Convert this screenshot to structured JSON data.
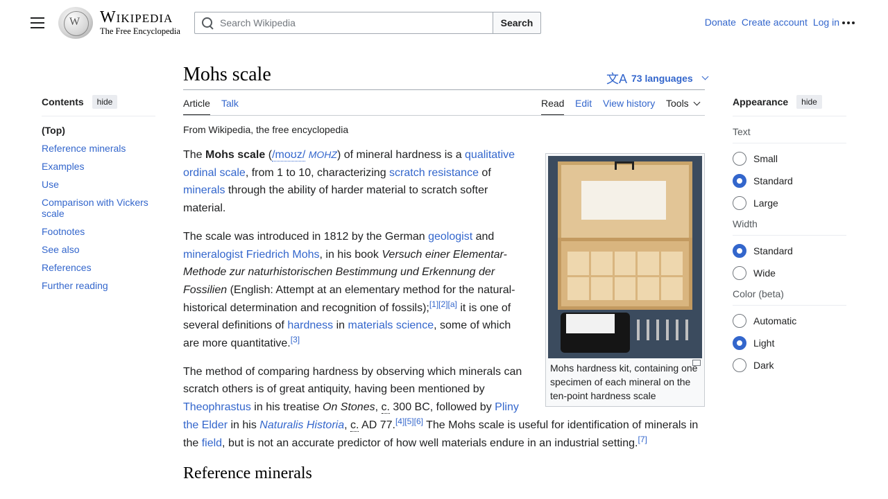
{
  "header": {
    "logo_title": "Wikipedia",
    "logo_tagline": "The Free Encyclopedia",
    "search_placeholder": "Search Wikipedia",
    "search_button": "Search",
    "user_links": [
      "Donate",
      "Create account",
      "Log in"
    ]
  },
  "article": {
    "title": "Mohs scale",
    "languages": "73 languages",
    "tabs_left": [
      "Article",
      "Talk"
    ],
    "tabs_right": [
      "Read",
      "Edit",
      "View history",
      "Tools"
    ],
    "from": "From Wikipedia, the free encyclopedia",
    "caption": "Mohs hardness kit, containing one specimen of each mineral on the ten-point hardness scale",
    "next_heading": "Reference minerals"
  },
  "toc": {
    "title": "Contents",
    "hide": "hide",
    "items": [
      "(Top)",
      "Reference minerals",
      "Examples",
      "Use",
      "Comparison with Vickers scale",
      "Footnotes",
      "See also",
      "References",
      "Further reading"
    ]
  },
  "appearance": {
    "title": "Appearance",
    "hide": "hide",
    "text_label": "Text",
    "text_options": [
      "Small",
      "Standard",
      "Large"
    ],
    "text_selected": "Standard",
    "width_label": "Width",
    "width_options": [
      "Standard",
      "Wide"
    ],
    "width_selected": "Standard",
    "color_label": "Color (beta)",
    "color_options": [
      "Automatic",
      "Light",
      "Dark"
    ],
    "color_selected": "Light"
  },
  "paragraphs": {
    "p1": [
      "The ",
      "Mohs scale",
      " (",
      "/moʊz/",
      " ",
      "MOHZ",
      ") of mineral hardness is a ",
      "qualitative ordinal scale",
      ", from 1 to 10, characterizing ",
      "scratch resistance",
      " of ",
      "minerals",
      " through the ability of harder material to scratch softer material."
    ],
    "p2": [
      "The scale was introduced in 1812 by the German ",
      "geologist",
      " and ",
      "mineralogist Friedrich Mohs",
      ", in his book ",
      "Versuch einer Elementar-Methode zur naturhistorischen Bestimmung und Erkennung der Fossilien",
      " (English: Attempt at an elementary method for the natural-historical determination and recognition of fossils);",
      "[1][2][a]",
      " it is one of several definitions of ",
      "hardness",
      " in ",
      "materials science",
      ", some of which are more quantitative.",
      "[3]"
    ],
    "p3": [
      "The method of comparing hardness by observing which minerals can scratch others is of great antiquity, having been mentioned by ",
      "Theophrastus",
      " in his treatise ",
      "On Stones",
      ", ",
      "c.",
      " 300 BC, followed by ",
      "Pliny the Elder",
      " in his ",
      "Naturalis Historia",
      ", ",
      "c.",
      " AD 77.",
      "[4][5][6]",
      " The Mohs scale is useful for identification of minerals in the ",
      "field",
      ", but is not an accurate predictor of how well materials endure in an industrial setting.",
      "[7]"
    ]
  }
}
